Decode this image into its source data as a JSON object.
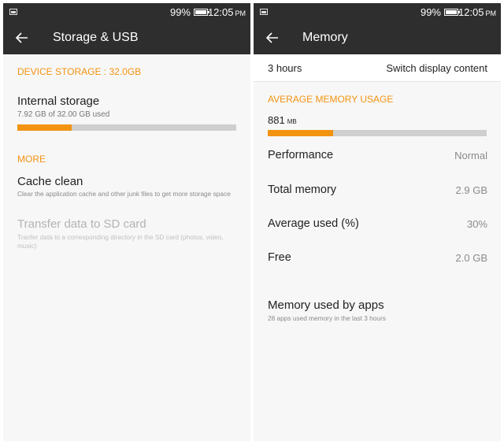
{
  "status_bar": {
    "battery_percent": "99%",
    "time": "12:05",
    "ampm": "PM",
    "left_icon": "image-icon",
    "battery_icon": "battery-icon"
  },
  "storage_screen": {
    "title": "Storage & USB",
    "device_storage_header": "DEVICE STORAGE : 32.0GB",
    "internal_storage": {
      "label": "Internal storage",
      "usage": "7.92 GB of 32.00 GB used",
      "used_fraction": 0.2475
    },
    "more_header": "MORE",
    "cache_clean": {
      "title": "Cache clean",
      "summary": "Clear the application cache and other junk files to get more storage space"
    },
    "transfer_sd": {
      "title": "Transfer data to SD card",
      "summary": "Tranfer data to a corresponding directory in the SD card (photos, video, music)"
    }
  },
  "memory_screen": {
    "title": "Memory",
    "duration": "3 hours",
    "switch_label": "Switch display content",
    "avg_header": "AVERAGE MEMORY USAGE",
    "avg_value": "881",
    "avg_unit": "MB",
    "avg_used_fraction": 0.3,
    "rows": [
      {
        "label": "Performance",
        "value": "Normal"
      },
      {
        "label": "Total memory",
        "value": "2.9 GB"
      },
      {
        "label": "Average used (%)",
        "value": "30%"
      },
      {
        "label": "Free",
        "value": "2.0 GB"
      }
    ],
    "apps": {
      "title": "Memory used by apps",
      "summary": "28 apps used memory in the last 3 hours"
    }
  },
  "colors": {
    "accent": "#f39312",
    "toolbar": "#2e2e2e",
    "track": "#cfcfcf"
  }
}
